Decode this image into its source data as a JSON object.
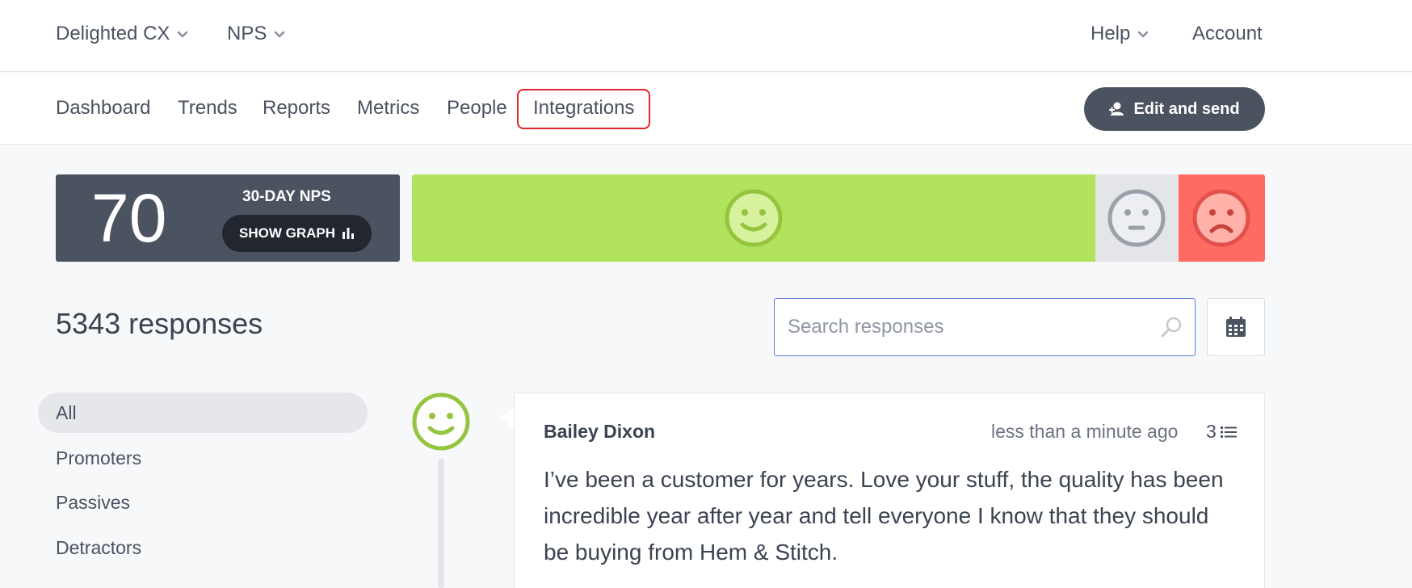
{
  "top_nav": {
    "brand": "Delighted CX",
    "survey_type": "NPS",
    "help": "Help",
    "account": "Account"
  },
  "main_nav": {
    "items": [
      "Dashboard",
      "Trends",
      "Reports",
      "Metrics",
      "People",
      "Integrations"
    ],
    "active_highlight": "Integrations",
    "edit_send_label": "Edit and send"
  },
  "nps": {
    "score": "70",
    "label": "30-DAY NPS",
    "show_graph_label": "SHOW GRAPH",
    "breakdown": {
      "promoters_fraction": 0.805,
      "passives_fraction": 0.098,
      "detractors_fraction": 0.102
    },
    "colors": {
      "promoters": "#b1e35c",
      "passives": "#e3e5e8",
      "detractors": "#ff6b63"
    }
  },
  "responses": {
    "count_label": "5343 responses",
    "search_placeholder": "Search responses"
  },
  "filters": [
    "All",
    "Promoters",
    "Passives",
    "Detractors"
  ],
  "response_item": {
    "name": "Bailey Dixon",
    "time": "less than a minute ago",
    "notes_count": "3",
    "text": "I’ve been a customer for years. Love your stuff, the quality has been incredible year after year and tell everyone I know that they should be buying from Hem & Stitch.",
    "sentiment_icon": "happy-face-icon"
  }
}
